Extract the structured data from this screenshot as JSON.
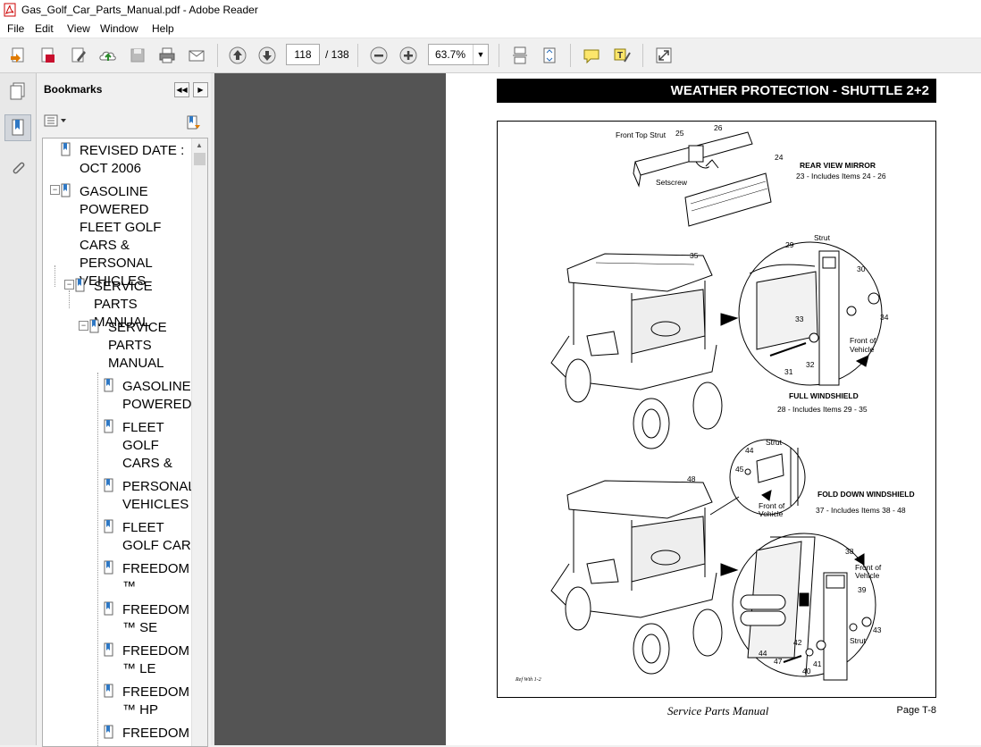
{
  "window": {
    "title": "Gas_Golf_Car_Parts_Manual.pdf - Adobe Reader"
  },
  "menu": [
    "File",
    "Edit",
    "View",
    "Window",
    "Help"
  ],
  "toolbar": {
    "page_current": "118",
    "page_total": "/ 138",
    "zoom": "63.7%"
  },
  "bookmarks": {
    "title": "Bookmarks",
    "items": [
      {
        "label": "REVISED DATE : OCT 2006"
      },
      {
        "label": "GASOLINE POWERED FLEET GOLF CARS & PERSONAL VEHICLES"
      },
      {
        "label": "SERVICE PARTS MANUAL"
      },
      {
        "label": "SERVICE PARTS MANUAL"
      },
      {
        "label": "GASOLINE POWERED"
      },
      {
        "label": "FLEET GOLF CARS &"
      },
      {
        "label": "PERSONAL VEHICLES"
      },
      {
        "label": "FLEET GOLF CAR"
      },
      {
        "label": "FREEDOM ™"
      },
      {
        "label": "FREEDOM ™ SE"
      },
      {
        "label": "FREEDOM ™ LE"
      },
      {
        "label": "FREEDOM ™ HP"
      },
      {
        "label": "FREEDOM"
      }
    ]
  },
  "document": {
    "header": "WEATHER PROTECTION - SHUTTLE 2+2",
    "footer_left": "Service Parts Manual",
    "footer_right": "Page T-8",
    "figure": {
      "top_labels": {
        "front_top_strut": "Front Top Strut",
        "setscrew": "Setscrew",
        "n25": "25",
        "n26": "26",
        "n24": "24"
      },
      "mirror_title": "REAR VIEW MIRROR",
      "mirror_sub": "23 - Includes Items 24 - 26",
      "full_title": "FULL WINDSHIELD",
      "full_sub": "28 - Includes Items 29 - 35",
      "fold_title": "FOLD DOWN WINDSHIELD",
      "fold_sub": "37 - Includes Items 38 - 48",
      "strut": "Strut",
      "front_of_vehicle_1": "Front of",
      "front_of_vehicle_2": "Vehicle",
      "ref": "Ref Wth 1-2",
      "nums_full": [
        "35",
        "29",
        "30",
        "33",
        "34",
        "31",
        "32"
      ],
      "nums_fold": [
        "48",
        "44",
        "45",
        "38",
        "39",
        "43",
        "42",
        "44",
        "47",
        "41",
        "40"
      ]
    }
  }
}
